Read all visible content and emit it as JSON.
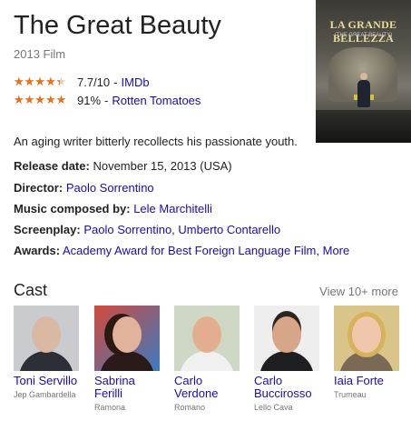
{
  "title": "The Great Beauty",
  "subtitle": "2013 Film",
  "poster": {
    "title": "LA GRANDE BELLEZZA",
    "subtitle": "(THE GREAT BEAUTY)"
  },
  "ratings": [
    {
      "score": "7.7/10",
      "source": "IMDb",
      "fraction": 0.77
    },
    {
      "score": "91%",
      "source": "Rotten Tomatoes",
      "fraction": 0.91
    }
  ],
  "description": "An aging writer bitterly recollects his passionate youth.",
  "facts": {
    "release": {
      "label": "Release date:",
      "value": "November 15, 2013 (USA)"
    },
    "director": {
      "label": "Director:",
      "value": "Paolo Sorrentino"
    },
    "music": {
      "label": "Music composed by:",
      "value": "Lele Marchitelli"
    },
    "screenplay": {
      "label": "Screenplay:",
      "value1": "Paolo Sorrentino",
      "sep": ", ",
      "value2": "Umberto Contarello"
    },
    "awards": {
      "label": "Awards:",
      "value1": "Academy Award for Best Foreign Language Film",
      "sep": ", ",
      "value2": "More"
    }
  },
  "cast": {
    "header": "Cast",
    "view_more": "View 10+ more",
    "members": [
      {
        "name": "Toni Servillo",
        "role": "Jep Gambardella"
      },
      {
        "name": "Sabrina Ferilli",
        "role": "Ramona"
      },
      {
        "name": "Carlo Verdone",
        "role": "Romano"
      },
      {
        "name": "Carlo Buccirosso",
        "role": "Lello Cava"
      },
      {
        "name": "Iaia Forte",
        "role": "Trumeau"
      }
    ]
  }
}
